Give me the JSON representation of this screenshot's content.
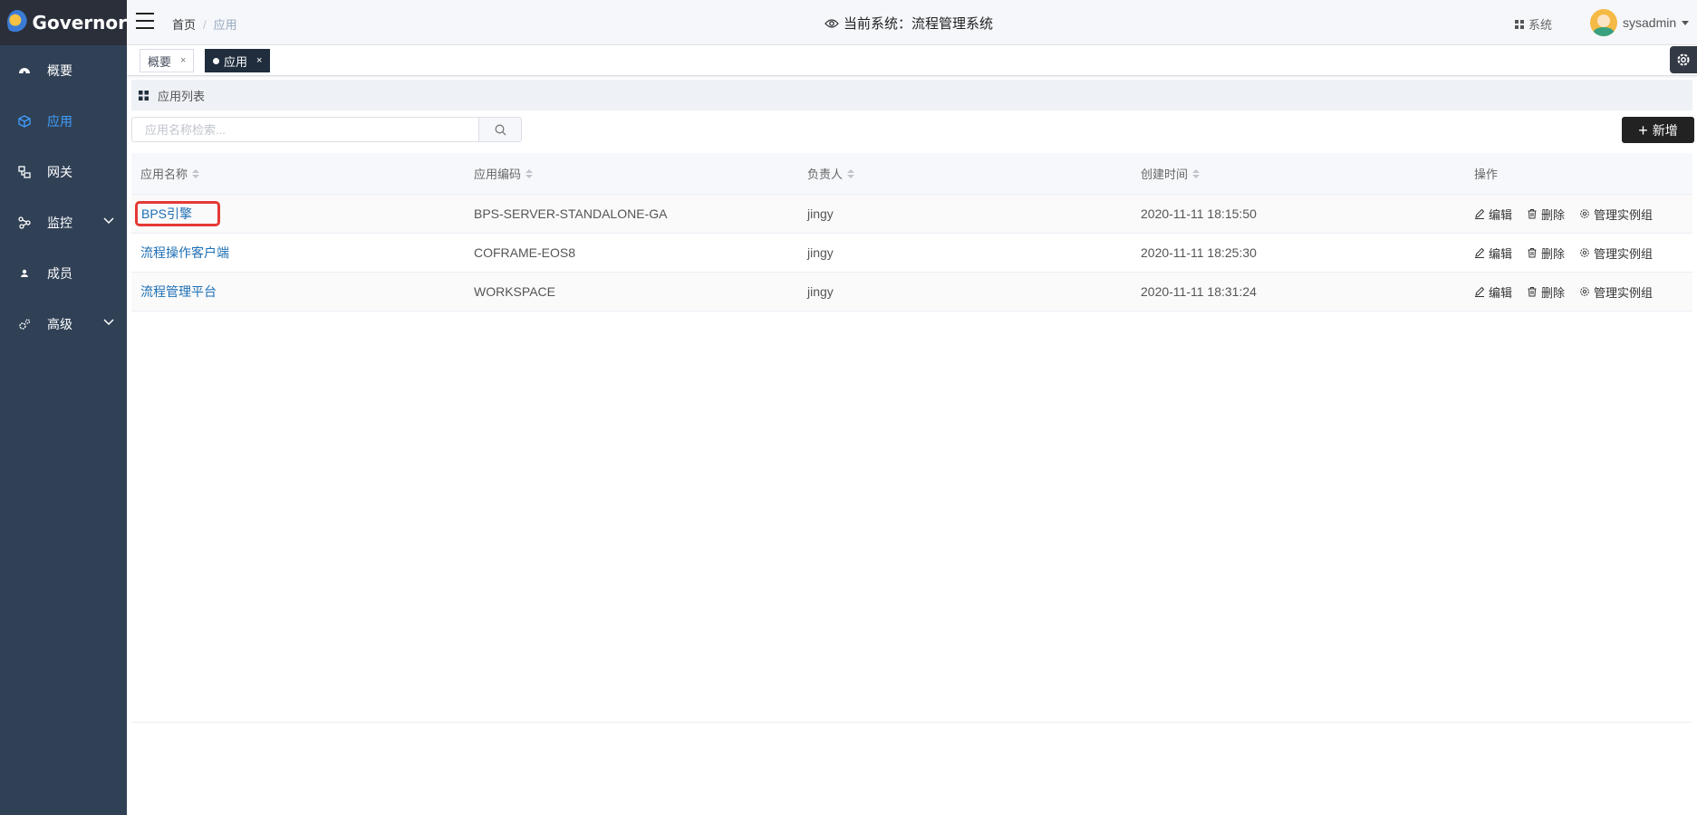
{
  "app": {
    "logo_text": "Governor"
  },
  "sidebar": {
    "items": [
      {
        "label": "概要",
        "icon": "dashboard-icon"
      },
      {
        "label": "应用",
        "icon": "cube-icon",
        "active": true
      },
      {
        "label": "网关",
        "icon": "gateway-icon"
      },
      {
        "label": "监控",
        "icon": "monitor-icon",
        "expandable": true
      },
      {
        "label": "成员",
        "icon": "user-icon"
      },
      {
        "label": "高级",
        "icon": "gears-icon",
        "expandable": true
      }
    ]
  },
  "header": {
    "breadcrumb": [
      "首页",
      "应用"
    ],
    "current_system": "当前系统：流程管理系统",
    "system_menu": "系统",
    "username": "sysadmin"
  },
  "tags": [
    {
      "label": "概要",
      "active": false
    },
    {
      "label": "应用",
      "active": true
    }
  ],
  "section": {
    "title": "应用列表"
  },
  "search": {
    "placeholder": "应用名称检索...",
    "value": ""
  },
  "toolbar": {
    "add_label": "新增"
  },
  "table": {
    "columns": [
      "应用名称",
      "应用编码",
      "负责人",
      "创建时间",
      "操作"
    ],
    "rows": [
      {
        "name": "BPS引擎",
        "code": "BPS-SERVER-STANDALONE-GA",
        "owner": "jingy",
        "created": "2020-11-11 18:15:50"
      },
      {
        "name": "流程操作客户端",
        "code": "COFRAME-EOS8",
        "owner": "jingy",
        "created": "2020-11-11 18:25:30"
      },
      {
        "name": "流程管理平台",
        "code": "WORKSPACE",
        "owner": "jingy",
        "created": "2020-11-11 18:31:24"
      }
    ],
    "actions": {
      "edit": "编辑",
      "delete": "删除",
      "manage": "管理实例组"
    }
  },
  "colors": {
    "sidebar_bg": "#304156",
    "active": "#409eff",
    "link": "#1e6fb5",
    "highlight": "#e53935"
  }
}
